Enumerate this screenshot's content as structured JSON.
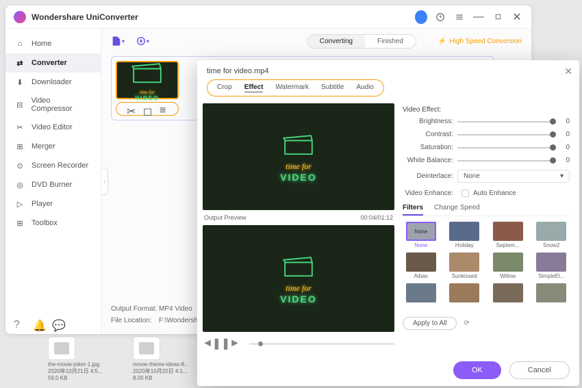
{
  "app": {
    "title": "Wondershare UniConverter"
  },
  "sidebar": {
    "items": [
      {
        "label": "Home"
      },
      {
        "label": "Converter"
      },
      {
        "label": "Downloader"
      },
      {
        "label": "Video Compressor"
      },
      {
        "label": "Video Editor"
      },
      {
        "label": "Merger"
      },
      {
        "label": "Screen Recorder"
      },
      {
        "label": "DVD Burner"
      },
      {
        "label": "Player"
      },
      {
        "label": "Toolbox"
      }
    ]
  },
  "toolbar": {
    "seg": {
      "a": "Converting",
      "b": "Finished"
    },
    "highspeed": "High Speed Conversion"
  },
  "meta": {
    "format_label": "Output Format:",
    "format_value": "MP4 Video",
    "location_label": "File Location:",
    "location_value": "F:\\Wondersh"
  },
  "modal": {
    "title": "time for video.mp4",
    "tabs": [
      "Crop",
      "Effect",
      "Watermark",
      "Subtitle",
      "Audio"
    ],
    "preview_label": "Output Preview",
    "time": "00:04/01:12",
    "effect": {
      "title": "Video Effect:",
      "sliders": [
        {
          "label": "Brightness:",
          "value": "0"
        },
        {
          "label": "Contrast:",
          "value": "0"
        },
        {
          "label": "Saturation:",
          "value": "0"
        },
        {
          "label": "White Balance:",
          "value": "0"
        }
      ],
      "deinterlace_label": "Deinterlace:",
      "deinterlace_value": "None",
      "enhance_label": "Video Enhance:",
      "auto_enhance": "Auto Enhance"
    },
    "subtabs": {
      "a": "Filters",
      "b": "Change Speed"
    },
    "filters": [
      "None",
      "Holiday",
      "Septem...",
      "Snow2",
      "Aibao",
      "Sunkissed",
      "Willow",
      "SimpleEl...",
      "",
      "",
      "",
      ""
    ],
    "apply_all": "Apply to All",
    "ok": "OK",
    "cancel": "Cancel"
  },
  "neon": {
    "line1": "time for",
    "line2": "VIDEO"
  },
  "desktop": [
    {
      "name": "the-movie-joker-1.jpg",
      "date": "2020年10月21日 4:5...",
      "size": "59.0 KB"
    },
    {
      "name": "movie-theme-ideas-8...",
      "date": "2020年10月20日 4:1...",
      "size": "8.00 KB"
    }
  ]
}
